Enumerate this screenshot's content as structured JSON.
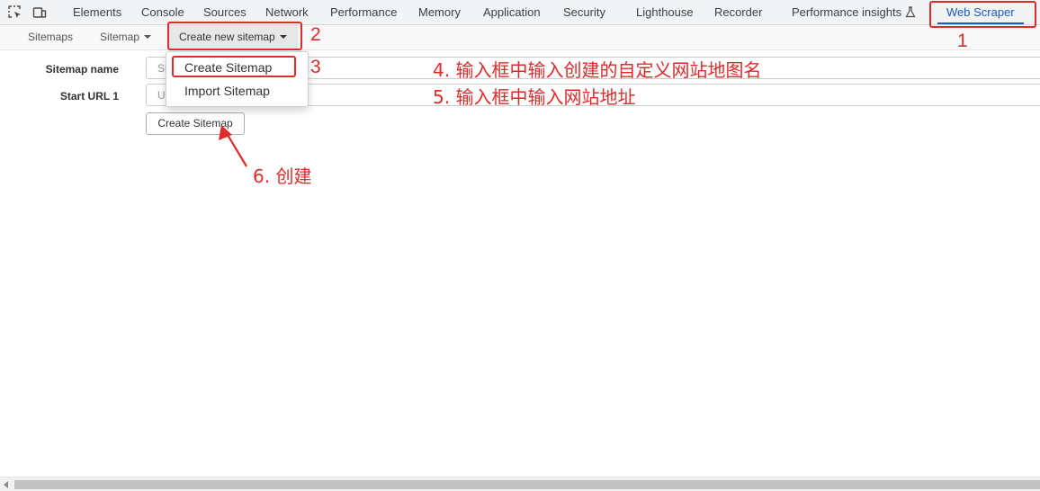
{
  "tabbar": {
    "icons": [
      "inspect-element-icon",
      "device-toolbar-icon"
    ],
    "tabs": [
      "Elements",
      "Console",
      "Sources",
      "Network",
      "Performance",
      "Memory",
      "Application",
      "Security",
      "Lighthouse",
      "Recorder",
      "Performance insights",
      "Web Scraper"
    ],
    "active_tab": "Web Scraper",
    "experiment_icon": "flask-icon"
  },
  "subnav": {
    "sitemaps": "Sitemaps",
    "sitemap": "Sitemap",
    "create_new": "Create new sitemap"
  },
  "dropdown": {
    "items": [
      "Create Sitemap",
      "Import Sitemap"
    ]
  },
  "form": {
    "sitemap_name_label": "Sitemap name",
    "sitemap_name_placeholder": "Sitemap name",
    "start_url_label": "Start URL 1",
    "start_url_placeholder": "URL",
    "create_button": "Create Sitemap"
  },
  "annotations": {
    "n1": "1",
    "n2": "2",
    "n3": "3",
    "step4": "4. 输入框中输入创建的自定义网站地图名",
    "step5": "5. 输入框中输入网站地址",
    "step6": "6. 创建"
  },
  "colors": {
    "annotation": "#e12a2a",
    "active_tab": "#1a57c9"
  }
}
